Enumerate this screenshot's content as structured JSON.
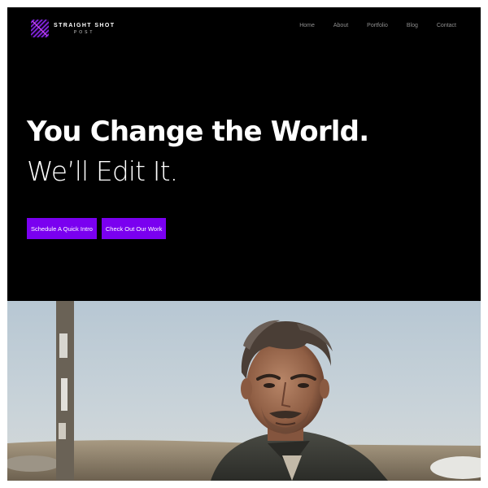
{
  "brand": {
    "name": "STRAIGHT SHOT",
    "tagline": "POST",
    "logo_icon": "logo-icon",
    "accent": "#7a00f0"
  },
  "nav": {
    "items": [
      "Home",
      "About",
      "Portfolio",
      "Blog",
      "Contact"
    ]
  },
  "hero": {
    "title": "You Change the World.",
    "subtitle": "We’ll Edit It.",
    "buttons": {
      "primary": "Schedule A Quick Intro",
      "secondary": "Check Out Our Work"
    }
  },
  "colors": {
    "background": "#000000",
    "button": "#7a00f0",
    "nav_text": "#8f8f8f"
  }
}
